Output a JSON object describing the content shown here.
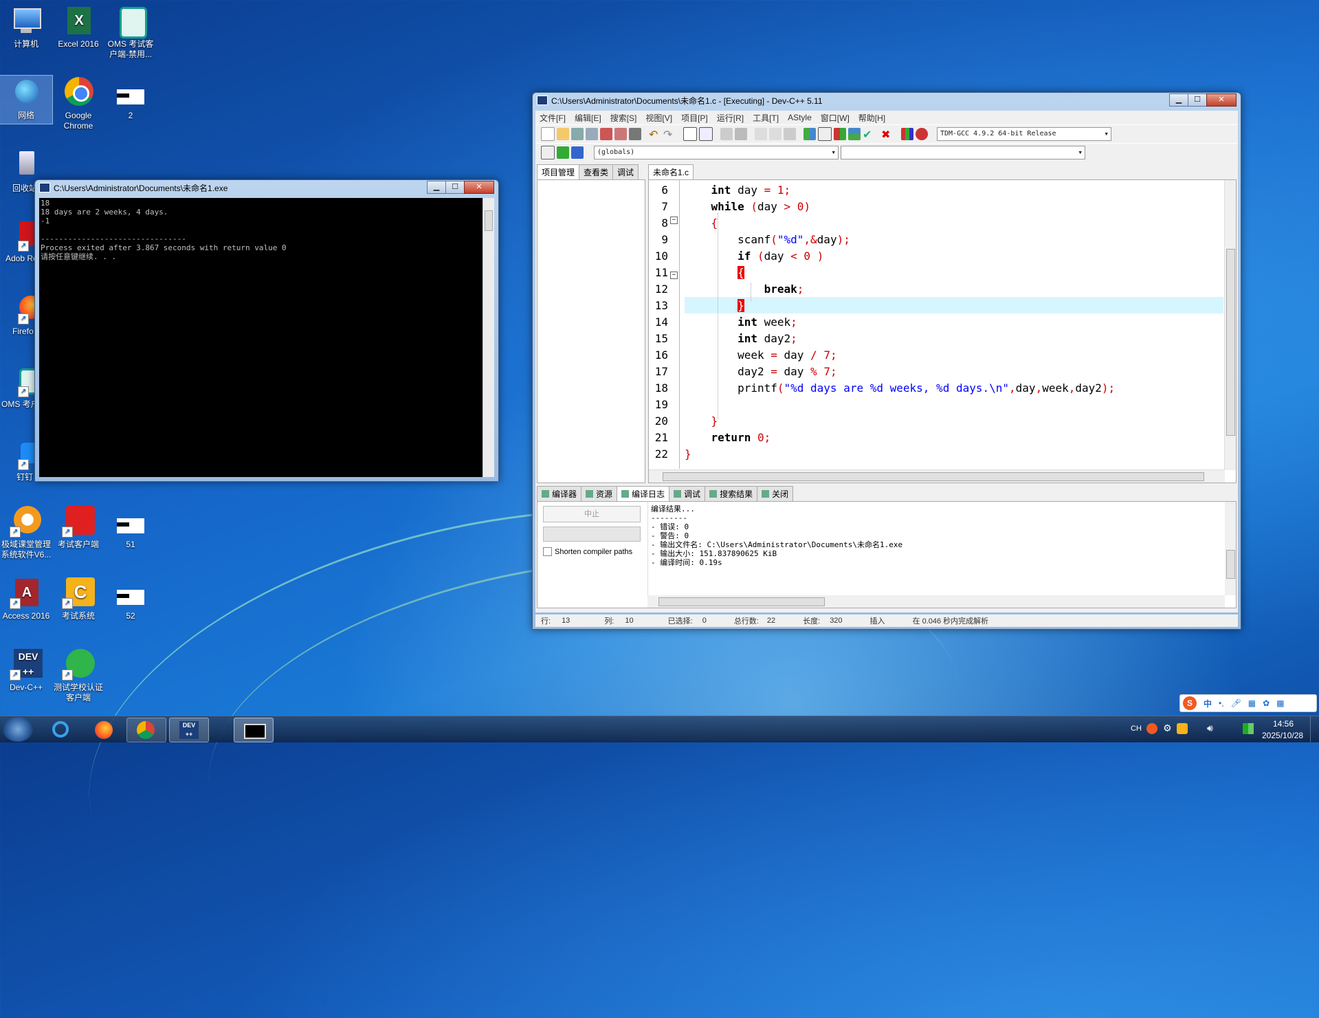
{
  "desktop": {
    "icons": [
      {
        "label": "计算机"
      },
      {
        "label": "Excel 2016"
      },
      {
        "label": "OMS 考试客户端-禁用..."
      },
      {
        "label": "网络"
      },
      {
        "label": "Google Chrome"
      },
      {
        "label": "2"
      },
      {
        "label": "回收站"
      },
      {
        "label": "Adob Reade"
      },
      {
        "label": "Firefo"
      },
      {
        "label": "OMS 考户端"
      },
      {
        "label": "钉钉"
      },
      {
        "label": "极域课堂管理系统软件V6..."
      },
      {
        "label": "考试客户端"
      },
      {
        "label": "51"
      },
      {
        "label": "Access 2016"
      },
      {
        "label": "考试系统"
      },
      {
        "label": "52"
      },
      {
        "label": "Dev-C++"
      },
      {
        "label": "测试学校认证客户端"
      }
    ]
  },
  "console_window": {
    "title": "C:\\Users\\Administrator\\Documents\\未命名1.exe",
    "lines": [
      "18",
      "18 days are 2 weeks, 4 days.",
      "-1",
      "",
      "--------------------------------",
      "Process exited after 3.867 seconds with return value 0",
      "请按任意键继续. . ."
    ]
  },
  "devcpp": {
    "title": "C:\\Users\\Administrator\\Documents\\未命名1.c - [Executing] - Dev-C++ 5.11",
    "menu": [
      "文件[F]",
      "编辑[E]",
      "搜索[S]",
      "视图[V]",
      "项目[P]",
      "运行[R]",
      "工具[T]",
      "AStyle",
      "窗口[W]",
      "帮助[H]"
    ],
    "compiler_select": "TDM-GCC 4.9.2 64-bit Release",
    "scope_select": "(globals)",
    "left_tabs": [
      "项目管理",
      "查看类",
      "调试"
    ],
    "file_tab": "未命名1.c",
    "line_numbers": [
      "6",
      "7",
      "8",
      "9",
      "10",
      "11",
      "12",
      "13",
      "14",
      "15",
      "16",
      "17",
      "18",
      "19",
      "20",
      "21",
      "22"
    ],
    "bottom_tabs": [
      "编译器",
      "资源",
      "编译日志",
      "调试",
      "搜索结果",
      "关闭"
    ],
    "abort_button": "中止",
    "shorten_paths": "Shorten compiler paths",
    "log": [
      "编译结果...",
      "--------",
      "- 错误: 0",
      "- 警告: 0",
      "- 输出文件名: C:\\Users\\Administrator\\Documents\\未命名1.exe",
      "- 输出大小: 151.837890625 KiB",
      "- 编译时间: 0.19s"
    ],
    "status": {
      "row_label": "行:",
      "row": "13",
      "col_label": "列:",
      "col": "10",
      "sel_label": "已选择:",
      "sel": "0",
      "lines_label": "总行数:",
      "lines": "22",
      "len_label": "长度:",
      "len": "320",
      "mode": "插入",
      "parse": "在 0.046 秒内完成解析"
    }
  },
  "taskbar": {
    "lang": "CH",
    "time": "14:56",
    "date": "2025/10/28"
  },
  "ime": {
    "label": "中"
  },
  "colors": {
    "accent": "#1a6fd0",
    "bracket_highlight": "#e00000",
    "current_line": "#d6f6ff"
  }
}
